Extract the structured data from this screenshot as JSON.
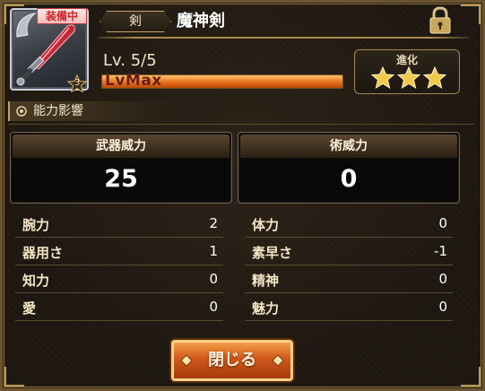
{
  "weapon": {
    "name": "魔神剣",
    "category": "剣",
    "equipped_badge": "装備中",
    "rarity": "3"
  },
  "level": {
    "text": "Lv. 5/5",
    "status": "LvMax",
    "progress": 1.0
  },
  "evolution": {
    "label": "進化",
    "stars": 3,
    "icon": "star-icon"
  },
  "section": {
    "title": "能力影響",
    "icon": "gear-icon"
  },
  "power": {
    "weapon_power_label": "武器威力",
    "weapon_power_value": "25",
    "magic_power_label": "術威力",
    "magic_power_value": "0"
  },
  "stats": {
    "left": [
      {
        "label": "腕力",
        "value": "2"
      },
      {
        "label": "器用さ",
        "value": "1"
      },
      {
        "label": "知力",
        "value": "0"
      },
      {
        "label": "愛",
        "value": "0"
      }
    ],
    "right": [
      {
        "label": "体力",
        "value": "0"
      },
      {
        "label": "素早さ",
        "value": "-1"
      },
      {
        "label": "精神",
        "value": "0"
      },
      {
        "label": "魅力",
        "value": "0"
      }
    ]
  },
  "close_button": {
    "label": "閉じる"
  },
  "lock": {
    "icon": "lock-icon"
  },
  "colors": {
    "accent_gold": "#c3a463",
    "button_orange": "#d0581a",
    "level_bar": "#e36b14"
  }
}
